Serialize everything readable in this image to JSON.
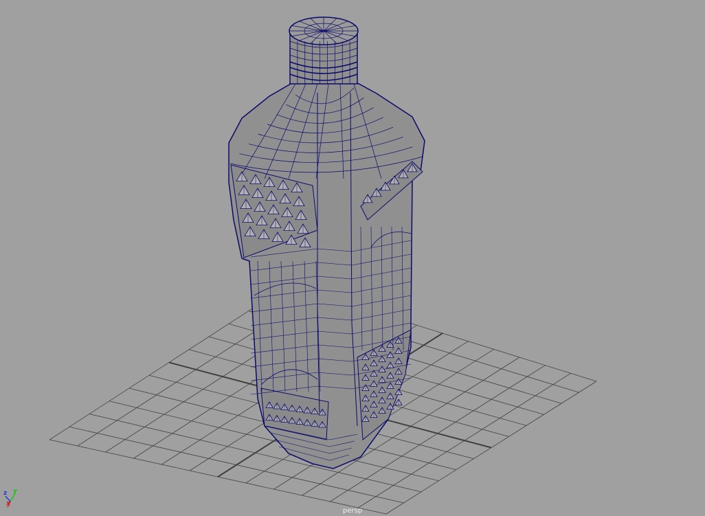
{
  "viewport": {
    "camera_name": "persp",
    "background_color": "#a0a0a0",
    "grid_color": "#404040",
    "wire_color": "#0a0a6a",
    "shaded_color": "#909090"
  },
  "axis_gizmo": {
    "x_label": "x",
    "y_label": "y",
    "z_label": "z",
    "x_color": "#d02020",
    "y_color": "#20c020",
    "z_color": "#2040d0"
  }
}
